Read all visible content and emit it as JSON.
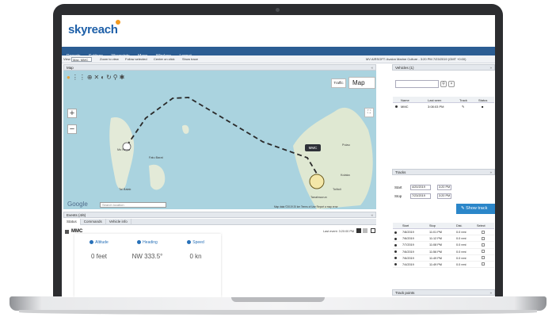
{
  "app": {
    "logo": "skyreach"
  },
  "menu": [
    "Reports",
    "Settings",
    "Waypoints",
    "Maps",
    "Wireless",
    "Logout"
  ],
  "toolbar": {
    "view_label": "View",
    "view_value": "Max: MMC",
    "options": [
      "Zoom to view",
      "Follow selected",
      "Center on click",
      "Show trace"
    ],
    "status_text": "MV AIRSOFT: Avalon Marine Culture - 3:20 PM 7/23/2019 (GMT +0:00)"
  },
  "map_panel": {
    "title": "Map",
    "traffic_label": "Traffic",
    "map_type": "Map",
    "search_placeholder": "Search location",
    "google": "Google",
    "attribution": "Map data ©2019   20 km           Terms of Use   Report a map error",
    "vehicle_marker": "MMC",
    "place_labels": [
      "Mo Rewa",
      "Fatu Barat",
      "Pulau",
      "Tai Balak",
      "Tolitoli",
      "Kolaka",
      "Tanahwurun"
    ]
  },
  "events_panel": {
    "title": "Events (4/6)",
    "tabs": [
      "Status",
      "Commands",
      "Vehicle info"
    ],
    "vehicle_name": "MMC",
    "last_event": "Last event: 3:20:00 PM",
    "cards": [
      {
        "label": "Altitude",
        "value": "0 feet"
      },
      {
        "label": "Heading",
        "value": "NW 333.5°"
      },
      {
        "label": "Speed",
        "value": "0 kn"
      }
    ]
  },
  "vehicles_panel": {
    "title": "Vehicles (1)",
    "columns": [
      "Name",
      "Last seen",
      "Track",
      "Status"
    ],
    "rows": [
      {
        "name": "MMC",
        "last_seen": "3:08:03 PM"
      }
    ]
  },
  "tracks_panel": {
    "title": "Tracks",
    "start_label": "Start",
    "start_date": "4/20/2019",
    "start_time": "3:20 PM",
    "end_label": "Stop",
    "end_date": "7/23/2019",
    "end_time": "3:20 PM",
    "show_track_label": "Show track",
    "columns": [
      "Start",
      "Stop",
      "Dist.",
      "Select"
    ],
    "rows": [
      {
        "start": "7/8/2019",
        "stop": "11:01 PM",
        "dist": "0.0 nmi"
      },
      {
        "start": "7/6/2019",
        "stop": "11:12 PM",
        "dist": "0.0 nmi"
      },
      {
        "start": "7/7/2019",
        "stop": "11:08 PM",
        "dist": "0.0 nmi"
      },
      {
        "start": "7/6/2019",
        "stop": "11:56 PM",
        "dist": "0.0 nmi"
      },
      {
        "start": "7/6/2019",
        "stop": "11:49 PM",
        "dist": "0.0 nmi"
      },
      {
        "start": "7/4/2019",
        "stop": "11:49 PM",
        "dist": "0.0 nmi"
      }
    ],
    "footer_title": "Track points"
  }
}
